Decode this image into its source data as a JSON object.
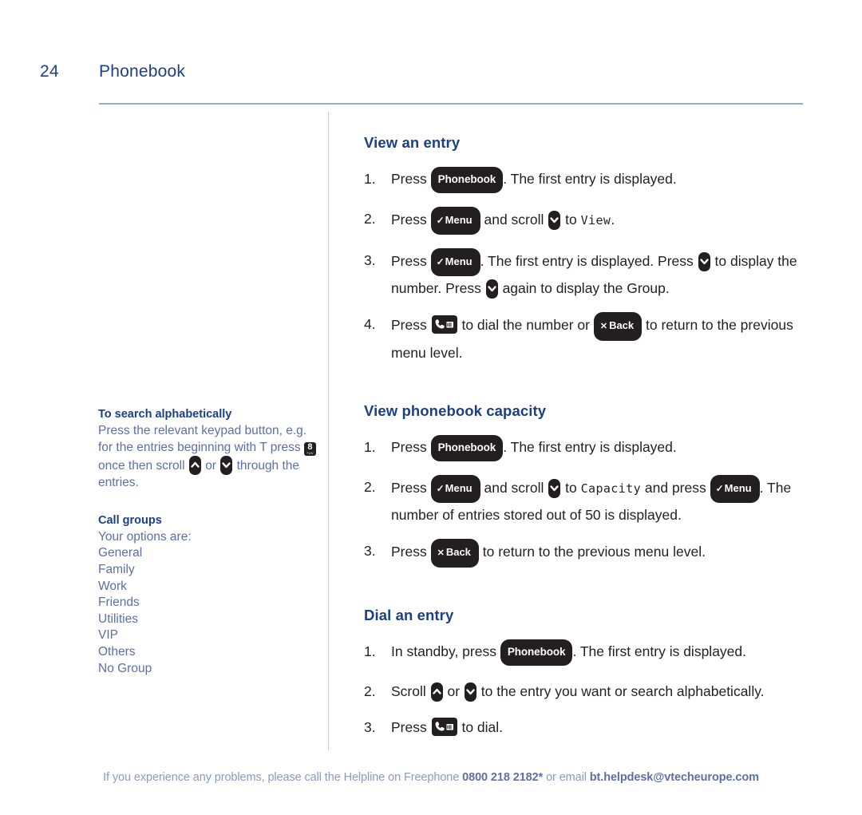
{
  "header": {
    "page_number": "24",
    "chapter_title": "Phonebook"
  },
  "sidebar": {
    "search_note": {
      "heading": "To search alphabetically",
      "text_before_key": "Press the relevant keypad button, e.g. for the entries beginning with T press",
      "key_number": "8",
      "key_letters": "TUV",
      "text_mid_1": "once then scroll",
      "text_or": "or",
      "text_after": "through the entries."
    },
    "call_groups": {
      "heading": "Call groups",
      "intro": "Your options are:",
      "items": [
        "General",
        "Family",
        "Work",
        "Friends",
        "Utilities",
        "VIP",
        "Others",
        "No Group"
      ]
    }
  },
  "main": {
    "sections": [
      {
        "title": "View an entry",
        "steps": [
          {
            "num": "1.",
            "parts": [
              {
                "t": "text",
                "v": "Press "
              },
              {
                "t": "key-phonebook",
                "v": "Phonebook"
              },
              {
                "t": "text",
                "v": ". The first entry is displayed."
              }
            ]
          },
          {
            "num": "2.",
            "parts": [
              {
                "t": "text",
                "v": "Press "
              },
              {
                "t": "key-menu",
                "v": "Menu"
              },
              {
                "t": "text",
                "v": " and scroll "
              },
              {
                "t": "scroll-down",
                "v": "scroll down"
              },
              {
                "t": "text",
                "v": " to "
              },
              {
                "t": "lcd",
                "v": "View"
              },
              {
                "t": "text",
                "v": "."
              }
            ]
          },
          {
            "num": "3.",
            "parts": [
              {
                "t": "text",
                "v": "Press "
              },
              {
                "t": "key-menu",
                "v": "Menu"
              },
              {
                "t": "text",
                "v": ". The first entry is displayed. Press "
              },
              {
                "t": "scroll-down",
                "v": "scroll down"
              },
              {
                "t": "text",
                "v": " to display the number. Press "
              },
              {
                "t": "scroll-down",
                "v": "scroll down"
              },
              {
                "t": "text",
                "v": " again to display the Group."
              }
            ]
          },
          {
            "num": "4.",
            "parts": [
              {
                "t": "text",
                "v": "Press "
              },
              {
                "t": "key-dial",
                "v": "dial"
              },
              {
                "t": "text",
                "v": " to dial the number or "
              },
              {
                "t": "key-back",
                "v": "Back"
              },
              {
                "t": "text",
                "v": " to return to the previous menu level."
              }
            ]
          }
        ]
      },
      {
        "title": "View phonebook capacity",
        "steps": [
          {
            "num": "1.",
            "parts": [
              {
                "t": "text",
                "v": "Press "
              },
              {
                "t": "key-phonebook",
                "v": "Phonebook"
              },
              {
                "t": "text",
                "v": ". The first entry is displayed."
              }
            ]
          },
          {
            "num": "2.",
            "parts": [
              {
                "t": "text",
                "v": "Press "
              },
              {
                "t": "key-menu",
                "v": "Menu"
              },
              {
                "t": "text",
                "v": " and scroll "
              },
              {
                "t": "scroll-down",
                "v": "scroll down"
              },
              {
                "t": "text",
                "v": " to "
              },
              {
                "t": "lcd",
                "v": "Capacity"
              },
              {
                "t": "text",
                "v": " and press "
              },
              {
                "t": "key-menu",
                "v": "Menu"
              },
              {
                "t": "text",
                "v": ". The number of entries stored out of 50 is displayed."
              }
            ]
          },
          {
            "num": "3.",
            "parts": [
              {
                "t": "text",
                "v": "Press "
              },
              {
                "t": "key-back",
                "v": "Back"
              },
              {
                "t": "text",
                "v": " to return to the previous menu level."
              }
            ]
          }
        ]
      },
      {
        "title": "Dial an entry",
        "steps": [
          {
            "num": "1.",
            "parts": [
              {
                "t": "text",
                "v": "In standby, press "
              },
              {
                "t": "key-phonebook",
                "v": "Phonebook"
              },
              {
                "t": "text",
                "v": ". The first entry is displayed."
              }
            ]
          },
          {
            "num": "2.",
            "parts": [
              {
                "t": "text",
                "v": "Scroll "
              },
              {
                "t": "scroll-up",
                "v": "scroll up"
              },
              {
                "t": "text",
                "v": " or "
              },
              {
                "t": "scroll-down",
                "v": "scroll down"
              },
              {
                "t": "text",
                "v": " to the entry you want or search alphabetically."
              }
            ]
          },
          {
            "num": "3.",
            "parts": [
              {
                "t": "text",
                "v": "Press "
              },
              {
                "t": "key-dial",
                "v": "dial"
              },
              {
                "t": "text",
                "v": " to dial."
              }
            ]
          }
        ]
      }
    ]
  },
  "footer": {
    "text_before": "If you experience any problems, please call the Helpline on Freephone ",
    "phone": "0800 218 2182*",
    "text_mid": " or email ",
    "email": "bt.helpdesk@vtecheurope.com"
  },
  "colors": {
    "heading_blue": "#1b3f87",
    "sidebar_blue": "#5d6fa6",
    "rule_blue": "#9aabc4",
    "key_dark": "#231f20",
    "footer_blue": "#8b9ac4"
  }
}
